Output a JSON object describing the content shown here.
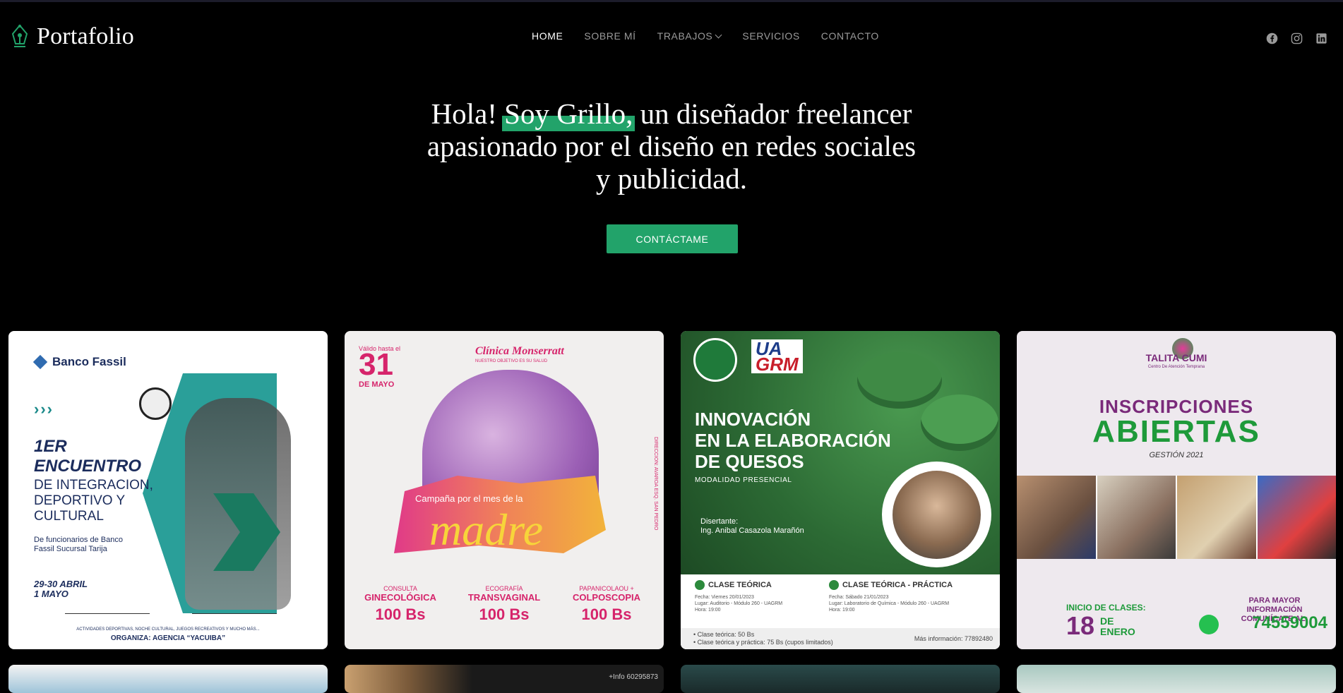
{
  "header": {
    "logo_text": "Portafolio",
    "logo_icon": "pen-nib-icon",
    "nav": [
      {
        "label": "HOME",
        "active": true
      },
      {
        "label": "SOBRE MÍ",
        "active": false
      },
      {
        "label": "TRABAJOS",
        "active": false,
        "has_dropdown": true
      },
      {
        "label": "SERVICIOS",
        "active": false
      },
      {
        "label": "CONTACTO",
        "active": false
      }
    ],
    "social_icons": [
      "facebook-icon",
      "instagram-icon",
      "linkedin-icon"
    ]
  },
  "hero": {
    "title_prefix": "Hola! ",
    "title_highlight": "Soy Grillo,",
    "title_suffix": " un diseñador freelancer apasionado por el diseño en redes sociales y publicidad.",
    "cta_label": "CONTÁCTAME"
  },
  "colors": {
    "background": "#000000",
    "accent": "#22a36a",
    "nav_inactive": "#9a9a9a"
  },
  "gallery": {
    "card1": {
      "bank": "Banco Fassil",
      "arrows": "›››",
      "heading": "1ER\nENCUENTRO",
      "subheading": "DE INTEGRACION, DEPORTIVO Y CULTURAL",
      "detail": "De funcionarios de Banco Fassil Sucursal Tarija",
      "dates": "29-30 ABRIL\n1 MAYO",
      "footer_small": "ACTIVIDADES DEPORTIVAS, NOCHE CULTURAL, JUEGOS RECREATIVOS Y MUCHO MÁS...",
      "footer": "ORGANIZA: AGENCIA “YACUIBA”"
    },
    "card2": {
      "valid": "Válido hasta el",
      "day": "31",
      "month": "DE MAYO",
      "clinic": "Clínica Monserratt",
      "clinic_sub": "NUESTRO OBJETIVO ES SU SALUD",
      "campaign": "Campaña por el mes de la",
      "madre": "madre",
      "side": "DIRECCION: AVAROA ESQ. SAN PEDRO",
      "services": [
        {
          "l1": "CONSULTA",
          "l2": "GINECOLÓGICA",
          "price": "100 Bs"
        },
        {
          "l1": "ECOGRAFÍA",
          "l2": "TRANSVAGINAL",
          "price": "100 Bs"
        },
        {
          "l1": "PAPANICOLAOU +",
          "l2": "COLPOSCOPIA",
          "price": "100 Bs"
        }
      ]
    },
    "card3": {
      "logo_text_a": "UA",
      "logo_text_b": "GRM",
      "title": "INNOVACIÓN\nEN LA ELABORACIÓN\nDE QUESOS",
      "mode": "MODALIDAD PRESENCIAL",
      "speaker_label": "Disertante:",
      "speaker": "Ing. Anibal Casazola Marañón",
      "col1_title": "CLASE TEÓRICA",
      "col1_text": "Fecha: Viernes 20/01/2023\nLugar: Auditorio - Módulo 260 - UAGRM\nHora: 19:00",
      "col2_title": "CLASE TEÓRICA - PRÁCTICA",
      "col2_text": "Fecha: Sábado 21/01/2023\nLugar: Laboratorio de Química - Módulo 260 - UAGRM\nHora: 19:00",
      "foot": "• Clase teórica: 50 Bs\n• Clase teórica y práctica: 75 Bs (cupos limitados)",
      "info": "Más información: 77892480"
    },
    "card4": {
      "name": "TALITA CUMI",
      "name_sub": "Centro De Atención Temprana",
      "line1": "INSCRIPCIONES",
      "line2": "ABIERTAS",
      "gestion": "GESTIÓN 2021",
      "inicio": "INICIO DE CLASES:",
      "day": "18",
      "month": "DE\nENERO",
      "more": "PARA MAYOR INFORMACIÓN COMUNÍCATE AL:",
      "phone": "74559004"
    },
    "row2_info": "+Info 60295873"
  }
}
